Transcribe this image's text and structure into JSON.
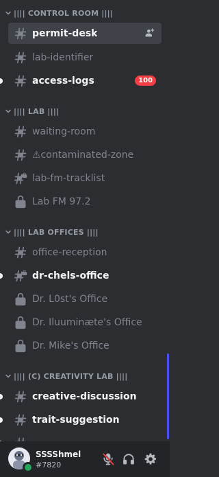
{
  "categories": {
    "control_room": "|||| CONTROL ROOM ||||",
    "lab": "|||| LAB ||||",
    "lab_offices": "|||| LAB OFFICES ||||",
    "creativity_lab": "|||| (C) CREATIVITY LAB ||||"
  },
  "channels": {
    "permit_desk": "permit-desk",
    "lab_identifier": "lab-identifier",
    "access_logs": "access-logs",
    "access_logs_badge": "100",
    "waiting_room": "waiting-room",
    "contaminated_zone": "⚠contaminated-zone",
    "lab_fm_tracklist": "lab-fm-tracklist",
    "lab_fm": "Lab FM 97.2",
    "office_reception": "office-reception",
    "dr_chels_office": "dr-chels-office",
    "dr_l0st": "Dr. L0st's Office",
    "dr_iluuminate": "Dr. Iluuminæte's Office",
    "dr_mike": "Dr. Mike's Office",
    "creative_discussion": "creative-discussion",
    "trait_suggestion": "trait-suggestion"
  },
  "user": {
    "name": "SSSShmel",
    "discriminator": "#7820"
  },
  "icons": {
    "text_channel": "hashtag-icon",
    "locked_text_channel": "hashtag-lock-icon",
    "voice_locked": "lock-icon",
    "category": "chevron-down-icon",
    "add_member": "add-member-icon",
    "mute": "microphone-muted-icon",
    "deafen": "headphones-icon",
    "settings": "gear-icon"
  },
  "colors": {
    "sidebar_bg": "#2b2d31",
    "userbar_bg": "#232428",
    "selected_bg": "#404249",
    "unread_text": "#f2f3f5",
    "muted_text": "#80848e",
    "badge": "#f23f43",
    "online": "#23a55a"
  }
}
